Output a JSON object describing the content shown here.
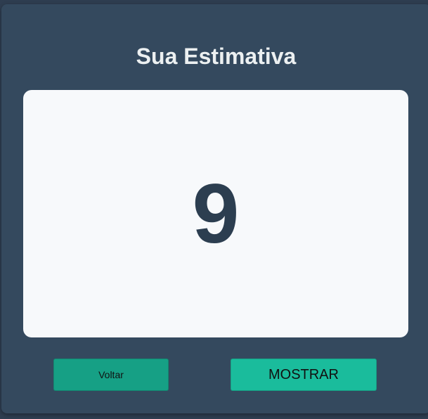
{
  "header": {
    "title": "Sua Estimativa"
  },
  "estimate": {
    "value": "9"
  },
  "actions": {
    "back_label": "Voltar",
    "show_label": "MOSTRAR"
  },
  "colors": {
    "background": "#2e3d50",
    "panel": "#34495e",
    "card": "#f7f9fb",
    "back_button": "#16a085",
    "show_button": "#1abc9c",
    "value_text": "#2c3e50"
  }
}
